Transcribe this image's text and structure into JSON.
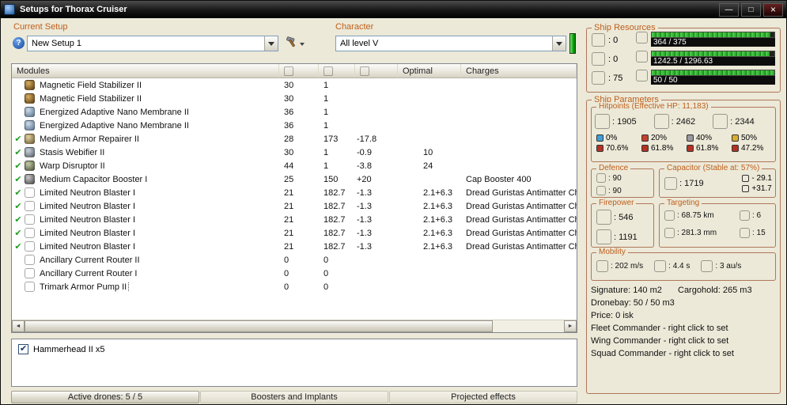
{
  "window": {
    "title": "Setups for Thorax Cruiser"
  },
  "setup": {
    "label": "Current Setup",
    "value": "New Setup 1"
  },
  "character": {
    "label": "Character",
    "value": "All level V"
  },
  "modules_table": {
    "headers": {
      "modules": "Modules",
      "optimal": "Optimal",
      "charges": "Charges"
    },
    "rows": [
      {
        "check": false,
        "selected": false,
        "icon": "magstab-icon",
        "name": "Magnetic Field Stabilizer II",
        "cpu": "30",
        "pg": "1",
        "cap": "",
        "optimal": "",
        "charges": ""
      },
      {
        "check": false,
        "selected": false,
        "icon": "magstab-icon",
        "name": "Magnetic Field Stabilizer II",
        "cpu": "30",
        "pg": "1",
        "cap": "",
        "optimal": "",
        "charges": ""
      },
      {
        "check": false,
        "selected": false,
        "icon": "eanm-icon",
        "name": "Energized Adaptive Nano Membrane II",
        "cpu": "36",
        "pg": "1",
        "cap": "",
        "optimal": "",
        "charges": ""
      },
      {
        "check": false,
        "selected": false,
        "icon": "eanm-icon",
        "name": "Energized Adaptive Nano Membrane II",
        "cpu": "36",
        "pg": "1",
        "cap": "",
        "optimal": "",
        "charges": ""
      },
      {
        "check": true,
        "selected": false,
        "icon": "armor-repairer-icon",
        "name": "Medium Armor Repairer II",
        "cpu": "28",
        "pg": "173",
        "cap": "-17.8",
        "optimal": "",
        "charges": ""
      },
      {
        "check": true,
        "selected": false,
        "icon": "web-icon",
        "name": "Stasis Webifier II",
        "cpu": "30",
        "pg": "1",
        "cap": "-0.9",
        "optimal": "10",
        "charges": ""
      },
      {
        "check": true,
        "selected": false,
        "icon": "disruptor-icon",
        "name": "Warp Disruptor II",
        "cpu": "44",
        "pg": "1",
        "cap": "-3.8",
        "optimal": "24",
        "charges": ""
      },
      {
        "check": true,
        "selected": false,
        "icon": "capbooster-icon",
        "name": "Medium Capacitor Booster I",
        "cpu": "25",
        "pg": "150",
        "cap": "+20",
        "optimal": "",
        "charges": "Cap Booster 400"
      },
      {
        "check": true,
        "selected": false,
        "icon": "blaster-icon",
        "name": "Limited Neutron Blaster I",
        "cpu": "21",
        "pg": "182.7",
        "cap": "-1.3",
        "optimal": "2.1+6.3",
        "charges": "Dread Guristas Antimatter Ch"
      },
      {
        "check": true,
        "selected": false,
        "icon": "blaster-icon",
        "name": "Limited Neutron Blaster I",
        "cpu": "21",
        "pg": "182.7",
        "cap": "-1.3",
        "optimal": "2.1+6.3",
        "charges": "Dread Guristas Antimatter Ch"
      },
      {
        "check": true,
        "selected": false,
        "icon": "blaster-icon",
        "name": "Limited Neutron Blaster I",
        "cpu": "21",
        "pg": "182.7",
        "cap": "-1.3",
        "optimal": "2.1+6.3",
        "charges": "Dread Guristas Antimatter Ch"
      },
      {
        "check": true,
        "selected": false,
        "icon": "blaster-icon",
        "name": "Limited Neutron Blaster I",
        "cpu": "21",
        "pg": "182.7",
        "cap": "-1.3",
        "optimal": "2.1+6.3",
        "charges": "Dread Guristas Antimatter Ch"
      },
      {
        "check": true,
        "selected": false,
        "icon": "blaster-icon",
        "name": "Limited Neutron Blaster I",
        "cpu": "21",
        "pg": "182.7",
        "cap": "-1.3",
        "optimal": "2.1+6.3",
        "charges": "Dread Guristas Antimatter Ch"
      },
      {
        "check": false,
        "selected": false,
        "icon": "rig-icon",
        "name": "Ancillary Current Router II",
        "cpu": "0",
        "pg": "0",
        "cap": "",
        "optimal": "",
        "charges": ""
      },
      {
        "check": false,
        "selected": false,
        "icon": "rig-icon",
        "name": "Ancillary Current Router I",
        "cpu": "0",
        "pg": "0",
        "cap": "",
        "optimal": "",
        "charges": ""
      },
      {
        "check": false,
        "selected": true,
        "icon": "rig-icon",
        "name": "Trimark Armor Pump II",
        "cpu": "0",
        "pg": "0",
        "cap": "",
        "optimal": "",
        "charges": ""
      }
    ]
  },
  "drones": {
    "items": [
      {
        "checked": true,
        "label": "Hammerhead II x5"
      }
    ]
  },
  "bottom_tabs": [
    {
      "label": "Active drones: 5 / 5"
    },
    {
      "label": "Boosters and Implants"
    },
    {
      "label": "Projected effects"
    }
  ],
  "resources": {
    "label": "Ship Resources",
    "slots": [
      {
        "icon": "turret-hardpoint-icon",
        "value": ": 0"
      },
      {
        "icon": "launcher-hardpoint-icon",
        "value": ": 0"
      },
      {
        "icon": "drone-bandwidth-icon",
        "value": ": 75"
      }
    ],
    "bars": [
      {
        "icon": "cpu-icon",
        "text": "364 / 375",
        "pct": 97
      },
      {
        "icon": "powergrid-icon",
        "text": "1242.5 / 1296.63",
        "pct": 96
      },
      {
        "icon": "calibration-icon",
        "text": "50 / 50",
        "pct": 100
      }
    ]
  },
  "parameters_label": "Ship Parameters",
  "hitpoints": {
    "label": "Hitpoints (Effective HP: 11,183)",
    "pools": [
      {
        "icon": "shield-icon",
        "value": ": 1905"
      },
      {
        "icon": "armor-icon",
        "value": ": 2462"
      },
      {
        "icon": "structure-icon",
        "value": ": 2344"
      }
    ],
    "resists": [
      {
        "type": "em",
        "color": "#3f9fd8",
        "shield": "0%",
        "armor": "70.6%"
      },
      {
        "type": "thermal",
        "color": "#c4402e",
        "shield": "20%",
        "armor": "61.8%"
      },
      {
        "type": "kinetic",
        "color": "#98989e",
        "shield": "40%",
        "armor": "61.8%"
      },
      {
        "type": "explosive",
        "color": "#d8ae2e",
        "shield": "50%",
        "armor": "47.2%"
      }
    ]
  },
  "defence": {
    "label": "Defence",
    "rows": [
      {
        "icon": "shield-recharge-icon",
        "value": ": 90"
      },
      {
        "icon": "armor-repair-icon",
        "value": ": 90"
      }
    ]
  },
  "capacitor": {
    "label": "Capacitor (Stable at: 57%)",
    "amount": {
      "icon": "capacitor-icon",
      "value": ": 1719"
    },
    "delta": [
      {
        "icon": "cap-minus-icon",
        "value": "- 29.1"
      },
      {
        "icon": "cap-plus-icon",
        "value": "+31.7"
      }
    ]
  },
  "firepower": {
    "label": "Firepower",
    "rows": [
      {
        "icon": "dps-icon",
        "value": ": 546"
      },
      {
        "icon": "volley-icon",
        "value": ": 1191"
      }
    ]
  },
  "targeting": {
    "label": "Targeting",
    "rows": [
      {
        "icon": "target-range-icon",
        "value": ": 68.75 km"
      },
      {
        "icon": "max-targets-icon",
        "value": ": 6"
      },
      {
        "icon": "scan-resolution-icon",
        "value": ": 281.3 mm"
      },
      {
        "icon": "sensor-strength-icon",
        "value": ": 15"
      }
    ]
  },
  "mobility": {
    "label": "Mobility",
    "rows": [
      {
        "icon": "speed-icon",
        "value": ": 202 m/s"
      },
      {
        "icon": "align-time-icon",
        "value": ": 4.4 s"
      },
      {
        "icon": "warp-speed-icon",
        "value": ": 3 au/s"
      }
    ]
  },
  "info": {
    "signature": "Signature: 140 m2",
    "cargohold": "Cargohold: 265 m3",
    "dronebay": "Dronebay: 50 / 50 m3",
    "price": "Price: 0 isk",
    "fleet": "Fleet Commander - right click to set",
    "wing": "Wing Commander - right click to set",
    "squad": "Squad Commander - right click to set"
  }
}
